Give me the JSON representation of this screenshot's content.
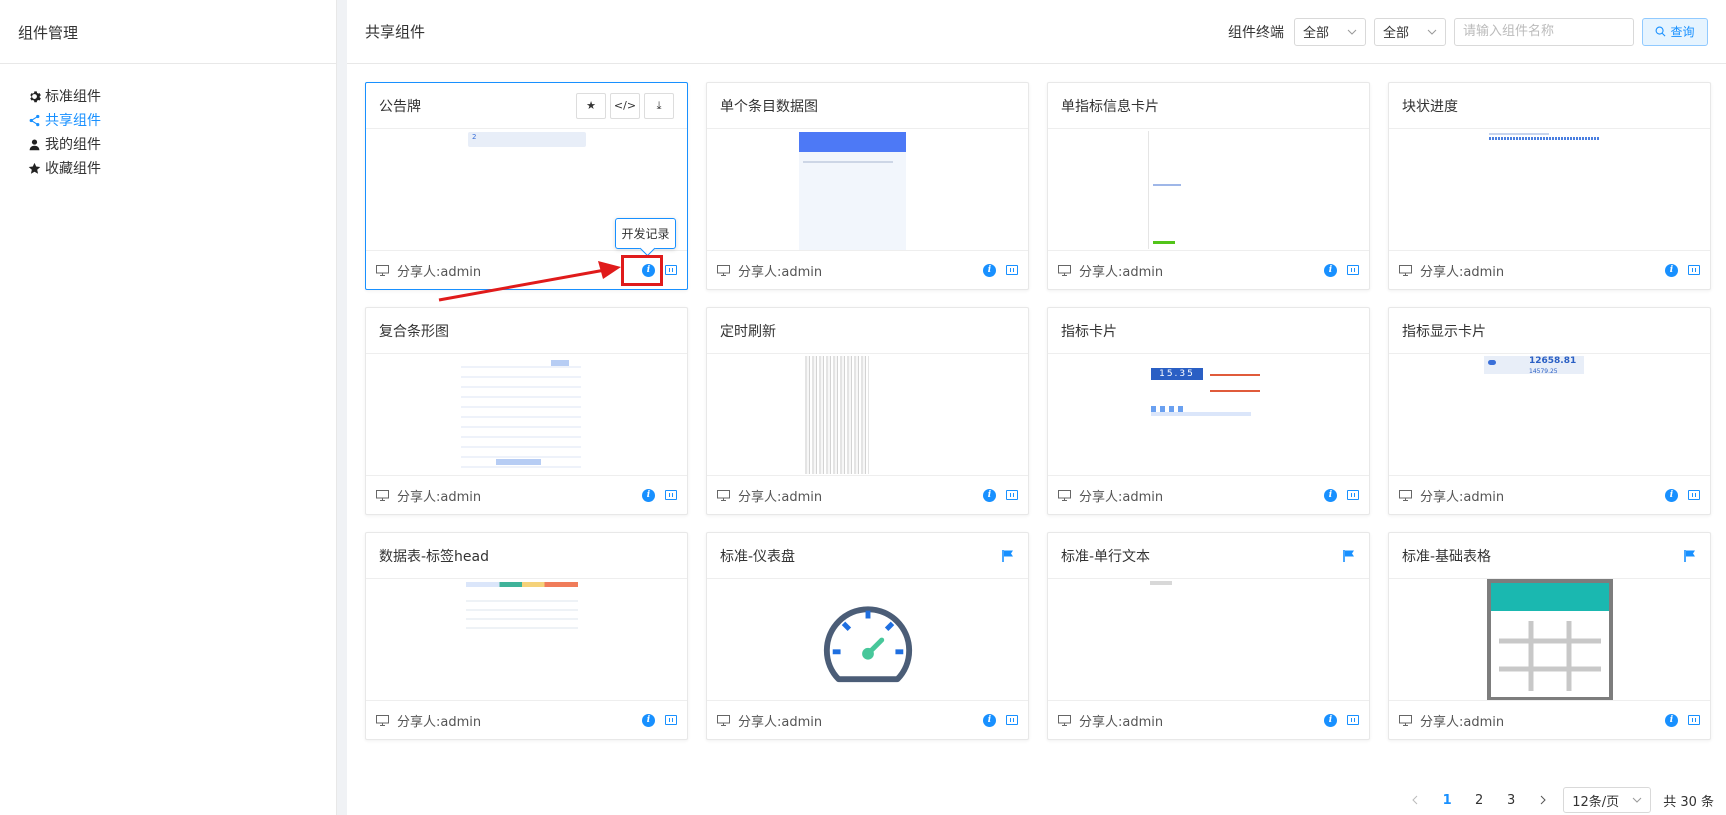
{
  "sidebar": {
    "title": "组件管理",
    "items": [
      {
        "label": "标准组件",
        "icon": "gear-icon",
        "active": false
      },
      {
        "label": "共享组件",
        "icon": "share-icon",
        "active": true
      },
      {
        "label": "我的组件",
        "icon": "user-icon",
        "active": false
      },
      {
        "label": "收藏组件",
        "icon": "star-icon",
        "active": false
      }
    ]
  },
  "header": {
    "title": "共享组件",
    "filter_label": "组件终端",
    "select1_value": "全部",
    "select2_value": "全部",
    "search_placeholder": "请输入组件名称",
    "query_label": "查询"
  },
  "tooltip": "开发记录",
  "cards": [
    {
      "title": "公告牌",
      "sharer": "分享人:admin"
    },
    {
      "title": "单个条目数据图",
      "sharer": "分享人:admin"
    },
    {
      "title": "单指标信息卡片",
      "sharer": "分享人:admin"
    },
    {
      "title": "块状进度",
      "sharer": "分享人:admin"
    },
    {
      "title": "复合条形图",
      "sharer": "分享人:admin"
    },
    {
      "title": "定时刷新",
      "sharer": "分享人:admin"
    },
    {
      "title": "指标卡片",
      "sharer": "分享人:admin"
    },
    {
      "title": "指标显示卡片",
      "sharer": "分享人:admin"
    },
    {
      "title": "数据表-标签head",
      "sharer": "分享人:admin"
    },
    {
      "title": "标准-仪表盘",
      "sharer": "分享人:admin"
    },
    {
      "title": "标准-单行文本",
      "sharer": "分享人:admin"
    },
    {
      "title": "标准-基础表格",
      "sharer": "分享人:admin"
    }
  ],
  "card_tools": {
    "star": "★",
    "code": "</>",
    "download": "⤓"
  },
  "previews": {
    "card1_text": "2",
    "card8_value": "12658.81",
    "card8_sub": "14579.25",
    "card7_digits": "15.35"
  },
  "pagination": {
    "pages": [
      "1",
      "2",
      "3"
    ],
    "current": "1",
    "page_size": "12条/页",
    "total": "共 30 条"
  },
  "colors": {
    "accent": "#1890ff",
    "highlight": "#e01b1b"
  }
}
